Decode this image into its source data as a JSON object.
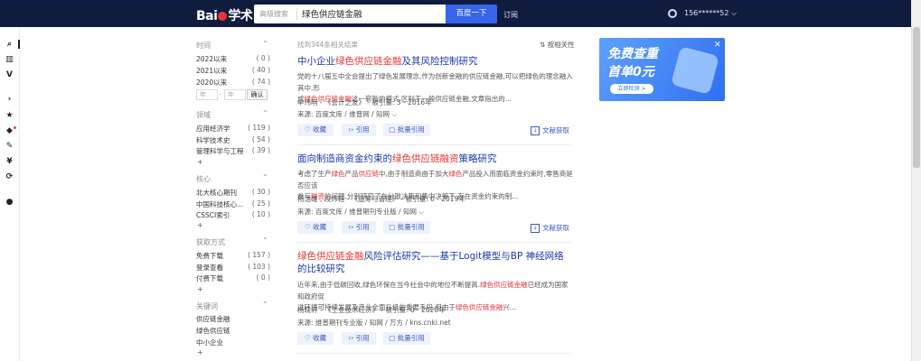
{
  "header": {
    "logo": "Bai",
    "logo_suffix": "学术",
    "adv_search": "高级搜索",
    "query": "绿色供应链金融",
    "search_btn": "百度一下",
    "subscribe": "订阅",
    "user": "156******52 ⌵"
  },
  "sidebar_icons": [
    "search-icon",
    "library-icon",
    "v-icon",
    "paper-icon",
    "star-icon",
    "box-icon",
    "pen-icon",
    "currency-icon",
    "refresh-icon",
    "user-icon"
  ],
  "facets": {
    "time": {
      "title": "时间",
      "rows": [
        {
          "label": "2022以来",
          "count": "( 0 )"
        },
        {
          "label": "2021以来",
          "count": "( 40 )"
        },
        {
          "label": "2020以来",
          "count": "( 74 )"
        }
      ],
      "from_placeholder": "年",
      "to_placeholder": "年",
      "confirm": "确认"
    },
    "field": {
      "title": "领域",
      "rows": [
        {
          "label": "应用经济学",
          "count": "( 119 )"
        },
        {
          "label": "科学技术史",
          "count": "( 54 )"
        },
        {
          "label": "管理科学与工程",
          "count": "( 39 )"
        }
      ],
      "more": "+"
    },
    "core": {
      "title": "核心",
      "rows": [
        {
          "label": "北大核心期刊",
          "count": "( 30 )"
        },
        {
          "label": "中国科技核心...",
          "count": "( 25 )"
        },
        {
          "label": "CSSCI索引",
          "count": "( 10 )"
        }
      ],
      "more": "+"
    },
    "access": {
      "title": "获取方式",
      "rows": [
        {
          "label": "免费下载",
          "count": "( 157 )"
        },
        {
          "label": "登录查看",
          "count": "( 103 )"
        },
        {
          "label": "付费下载",
          "count": "( 0 )"
        }
      ],
      "more": "+"
    },
    "keywords": {
      "title": "关键词",
      "rows": [
        {
          "label": "供应链金融"
        },
        {
          "label": "绿色供应链"
        },
        {
          "label": "中小企业"
        }
      ],
      "more": "+"
    }
  },
  "results_info": {
    "found": "找到344条相关结果",
    "sort": "按相关性"
  },
  "results": [
    {
      "title": [
        "中小企业",
        "绿色供应链金融",
        "及其风险控制研究"
      ],
      "abs1": [
        "党的十八届五中全会提出了绿色发展理念,作为创新金融的供应链金融,可以把绿色的理念融入其中.形"
      ],
      "abs2": [
        "成",
        "绿色供应链金融",
        "这一崭新的模式.区别于一般供应链金融,文章指出的..."
      ],
      "meta": "牟伟明 - 《会计之友》 - 被引量: 3 - 2016年",
      "src": "来源: 百度文库 / 维普网 / 知网 ⌵"
    },
    {
      "title": [
        "面向制造商资金约束的",
        "绿色供应链融资",
        "策略研究"
      ],
      "abs1": [
        "考虑了生产",
        "绿色",
        "产品",
        "供应链",
        "中,由于制造商由于加大",
        "绿色",
        "产品投入而面临资金约束时,零售商是否应该"
      ],
      "abs2": [
        "参与",
        "融资",
        "的问题.分别研究了在分散决策和集中决策下,存在资金约束的制..."
      ],
      "meta": "杨浩雄 , 段炜钰 - 《运筹与管理》 - 被引量: 0 - 2019年",
      "src": "来源: 百度文库 / 维普期刊专业版 / 知网 ⌵"
    },
    {
      "title": [
        "绿色供应链金融",
        "风险评估研究——基于Logit模型与BP 神经网络的比较研究"
      ],
      "abs1": [
        "近年来,由于低碳回收,绿色环保在当今社会中的地位不断提高.",
        "绿色供应链金融",
        "已经成为国家和政府促"
      ],
      "abs2": [
        "进环境可持续发展及产业全面升级的重要手段.但由于",
        "绿色供应链金融",
        "兴..."
      ],
      "meta": "杨晓轩 - 《工业技术经济》 - 被引量: 0 - 2020年",
      "src": "来源: 维普期刊专业版 / 知网 / 万方 / kns.cnki.net"
    }
  ],
  "actions": {
    "collect": "收藏",
    "cite": "引用",
    "batch": "批量引用",
    "download": "文献获取"
  },
  "ad": {
    "line1": "免费查重",
    "line2": "首单0元",
    "cta": "立即检测 >",
    "close": "✕"
  }
}
